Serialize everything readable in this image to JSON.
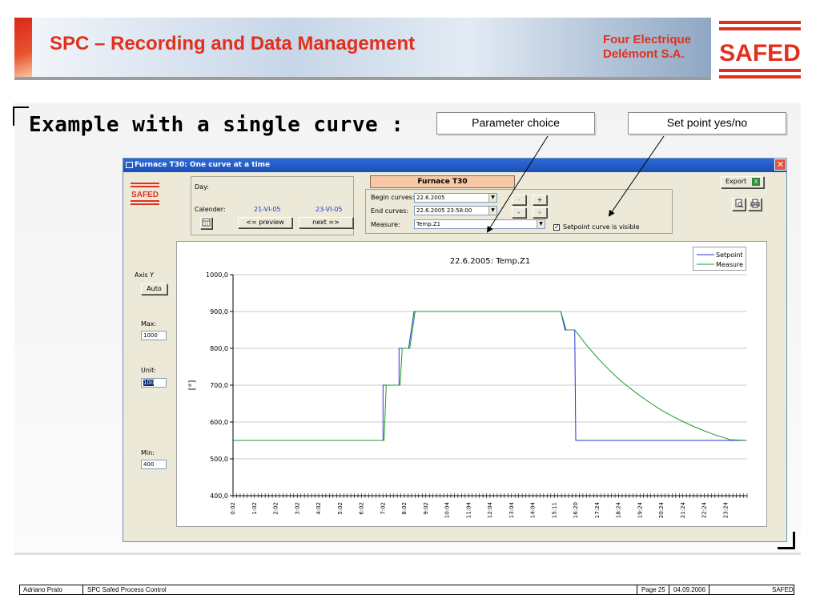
{
  "slide": {
    "title": "SPC – Recording and Data Management",
    "company_line1": "Four Electrique",
    "company_line2": "Delémont S.A.",
    "brand": "SAFED",
    "heading": "Example with a single curve :",
    "callout_parameter": "Parameter choice",
    "callout_setpoint": "Set point yes/no"
  },
  "window": {
    "title": "Furnace T30: One curve at a time",
    "close": "✕",
    "logo": "SAFED",
    "furnace_tab": "Furnace T30",
    "day_label": "Day:",
    "calendar_label": "Calender:",
    "date_prev": "21-VI-05",
    "date_next": "23-VI-05",
    "preview_btn": "<= preview",
    "next_btn": "next =>",
    "begin_label": "Begin curves:",
    "begin_value": "22.6.2005",
    "end_label": "End curves:",
    "end_value": "22.6.2005 23:58:00",
    "measure_label": "Measure:",
    "measure_value": "Temp.Z1",
    "minus": "-",
    "plus": "+",
    "setpoint_check_label": "Setpoint curve is visible",
    "setpoint_checked": true,
    "export_label": "Export",
    "axis_y_label": "Axis Y",
    "auto_btn": "Auto",
    "max_label": "Max:",
    "max_value": "1000",
    "unit_label": "Unit:",
    "unit_value": "100",
    "min_label": "Min:",
    "min_value": "400"
  },
  "chart_data": {
    "type": "line",
    "title": "22.6.2005: Temp.Z1",
    "ylabel": "[°]",
    "xlabel": "",
    "ylim": [
      400,
      1000
    ],
    "yticks": [
      "1000,0",
      "900,0",
      "800,0",
      "700,0",
      "600,0",
      "500,0",
      "400,0"
    ],
    "xticks": [
      "0:02",
      "1:02",
      "2:02",
      "3:02",
      "4:02",
      "5:02",
      "6:02",
      "7:02",
      "8:02",
      "9:02",
      "10:04",
      "11:04",
      "12:04",
      "13:04",
      "14:04",
      "15:11",
      "16:20",
      "17:24",
      "18:24",
      "19:24",
      "20:24",
      "21:24",
      "22:24",
      "23:24"
    ],
    "grid": true,
    "legend_position": "top-right",
    "series": [
      {
        "name": "Setpoint",
        "color": "#2a33d8",
        "points": [
          [
            0.03,
            550
          ],
          [
            7.0,
            550
          ],
          [
            7.0,
            700
          ],
          [
            7.75,
            700
          ],
          [
            7.75,
            800
          ],
          [
            8.2,
            800
          ],
          [
            8.45,
            900
          ],
          [
            15.3,
            900
          ],
          [
            15.5,
            850
          ],
          [
            15.95,
            850
          ],
          [
            16.0,
            550
          ],
          [
            23.98,
            550
          ]
        ]
      },
      {
        "name": "Measure",
        "color": "#1c9a2a",
        "points": [
          [
            0.03,
            550
          ],
          [
            7.05,
            550
          ],
          [
            7.15,
            700
          ],
          [
            7.8,
            700
          ],
          [
            7.9,
            800
          ],
          [
            8.25,
            800
          ],
          [
            8.5,
            900
          ],
          [
            15.3,
            900
          ],
          [
            15.55,
            850
          ],
          [
            15.95,
            850
          ],
          [
            16.5,
            809
          ],
          [
            17.0,
            775
          ],
          [
            17.5,
            745
          ],
          [
            18.0,
            717
          ],
          [
            18.5,
            693
          ],
          [
            19.0,
            671
          ],
          [
            19.5,
            651
          ],
          [
            20.0,
            632
          ],
          [
            20.5,
            616
          ],
          [
            21.0,
            601
          ],
          [
            21.5,
            588
          ],
          [
            22.0,
            576
          ],
          [
            22.5,
            565
          ],
          [
            23.0,
            556
          ],
          [
            23.2,
            552
          ],
          [
            23.98,
            550
          ]
        ]
      }
    ]
  },
  "footer": {
    "author": "Adriano Prato",
    "doc": "SPC Safed Process Control",
    "page": "Page 25",
    "date": "04.09.2006",
    "brand": "SAFED"
  }
}
